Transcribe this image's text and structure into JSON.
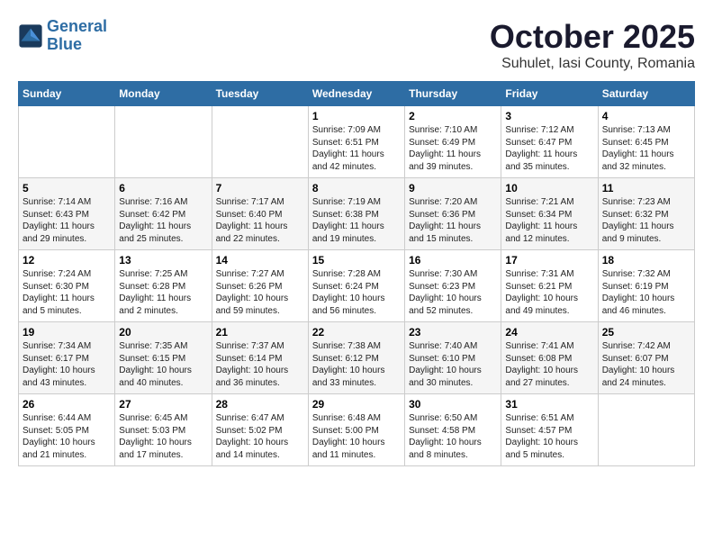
{
  "header": {
    "logo_line1": "General",
    "logo_line2": "Blue",
    "title": "October 2025",
    "subtitle": "Suhulet, Iasi County, Romania"
  },
  "weekdays": [
    "Sunday",
    "Monday",
    "Tuesday",
    "Wednesday",
    "Thursday",
    "Friday",
    "Saturday"
  ],
  "weeks": [
    [
      {
        "day": "",
        "content": ""
      },
      {
        "day": "",
        "content": ""
      },
      {
        "day": "",
        "content": ""
      },
      {
        "day": "1",
        "content": "Sunrise: 7:09 AM\nSunset: 6:51 PM\nDaylight: 11 hours\nand 42 minutes."
      },
      {
        "day": "2",
        "content": "Sunrise: 7:10 AM\nSunset: 6:49 PM\nDaylight: 11 hours\nand 39 minutes."
      },
      {
        "day": "3",
        "content": "Sunrise: 7:12 AM\nSunset: 6:47 PM\nDaylight: 11 hours\nand 35 minutes."
      },
      {
        "day": "4",
        "content": "Sunrise: 7:13 AM\nSunset: 6:45 PM\nDaylight: 11 hours\nand 32 minutes."
      }
    ],
    [
      {
        "day": "5",
        "content": "Sunrise: 7:14 AM\nSunset: 6:43 PM\nDaylight: 11 hours\nand 29 minutes."
      },
      {
        "day": "6",
        "content": "Sunrise: 7:16 AM\nSunset: 6:42 PM\nDaylight: 11 hours\nand 25 minutes."
      },
      {
        "day": "7",
        "content": "Sunrise: 7:17 AM\nSunset: 6:40 PM\nDaylight: 11 hours\nand 22 minutes."
      },
      {
        "day": "8",
        "content": "Sunrise: 7:19 AM\nSunset: 6:38 PM\nDaylight: 11 hours\nand 19 minutes."
      },
      {
        "day": "9",
        "content": "Sunrise: 7:20 AM\nSunset: 6:36 PM\nDaylight: 11 hours\nand 15 minutes."
      },
      {
        "day": "10",
        "content": "Sunrise: 7:21 AM\nSunset: 6:34 PM\nDaylight: 11 hours\nand 12 minutes."
      },
      {
        "day": "11",
        "content": "Sunrise: 7:23 AM\nSunset: 6:32 PM\nDaylight: 11 hours\nand 9 minutes."
      }
    ],
    [
      {
        "day": "12",
        "content": "Sunrise: 7:24 AM\nSunset: 6:30 PM\nDaylight: 11 hours\nand 5 minutes."
      },
      {
        "day": "13",
        "content": "Sunrise: 7:25 AM\nSunset: 6:28 PM\nDaylight: 11 hours\nand 2 minutes."
      },
      {
        "day": "14",
        "content": "Sunrise: 7:27 AM\nSunset: 6:26 PM\nDaylight: 10 hours\nand 59 minutes."
      },
      {
        "day": "15",
        "content": "Sunrise: 7:28 AM\nSunset: 6:24 PM\nDaylight: 10 hours\nand 56 minutes."
      },
      {
        "day": "16",
        "content": "Sunrise: 7:30 AM\nSunset: 6:23 PM\nDaylight: 10 hours\nand 52 minutes."
      },
      {
        "day": "17",
        "content": "Sunrise: 7:31 AM\nSunset: 6:21 PM\nDaylight: 10 hours\nand 49 minutes."
      },
      {
        "day": "18",
        "content": "Sunrise: 7:32 AM\nSunset: 6:19 PM\nDaylight: 10 hours\nand 46 minutes."
      }
    ],
    [
      {
        "day": "19",
        "content": "Sunrise: 7:34 AM\nSunset: 6:17 PM\nDaylight: 10 hours\nand 43 minutes."
      },
      {
        "day": "20",
        "content": "Sunrise: 7:35 AM\nSunset: 6:15 PM\nDaylight: 10 hours\nand 40 minutes."
      },
      {
        "day": "21",
        "content": "Sunrise: 7:37 AM\nSunset: 6:14 PM\nDaylight: 10 hours\nand 36 minutes."
      },
      {
        "day": "22",
        "content": "Sunrise: 7:38 AM\nSunset: 6:12 PM\nDaylight: 10 hours\nand 33 minutes."
      },
      {
        "day": "23",
        "content": "Sunrise: 7:40 AM\nSunset: 6:10 PM\nDaylight: 10 hours\nand 30 minutes."
      },
      {
        "day": "24",
        "content": "Sunrise: 7:41 AM\nSunset: 6:08 PM\nDaylight: 10 hours\nand 27 minutes."
      },
      {
        "day": "25",
        "content": "Sunrise: 7:42 AM\nSunset: 6:07 PM\nDaylight: 10 hours\nand 24 minutes."
      }
    ],
    [
      {
        "day": "26",
        "content": "Sunrise: 6:44 AM\nSunset: 5:05 PM\nDaylight: 10 hours\nand 21 minutes."
      },
      {
        "day": "27",
        "content": "Sunrise: 6:45 AM\nSunset: 5:03 PM\nDaylight: 10 hours\nand 17 minutes."
      },
      {
        "day": "28",
        "content": "Sunrise: 6:47 AM\nSunset: 5:02 PM\nDaylight: 10 hours\nand 14 minutes."
      },
      {
        "day": "29",
        "content": "Sunrise: 6:48 AM\nSunset: 5:00 PM\nDaylight: 10 hours\nand 11 minutes."
      },
      {
        "day": "30",
        "content": "Sunrise: 6:50 AM\nSunset: 4:58 PM\nDaylight: 10 hours\nand 8 minutes."
      },
      {
        "day": "31",
        "content": "Sunrise: 6:51 AM\nSunset: 4:57 PM\nDaylight: 10 hours\nand 5 minutes."
      },
      {
        "day": "",
        "content": ""
      }
    ]
  ]
}
